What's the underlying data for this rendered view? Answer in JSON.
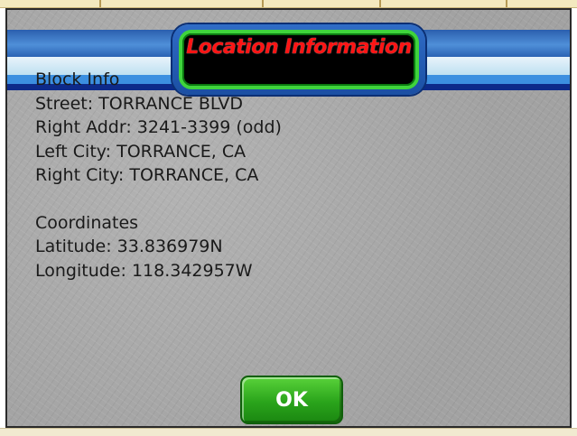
{
  "dialog": {
    "title": "Location Information",
    "block_info": {
      "heading": "Block Info",
      "street": "Street:  TORRANCE BLVD",
      "right_addr": "Right Addr:  3241-3399 (odd)",
      "left_city": "Left City:  TORRANCE, CA",
      "right_city": "Right City:  TORRANCE, CA"
    },
    "coordinates": {
      "heading": "Coordinates",
      "latitude": "Latitude:  33.836979N",
      "longitude": "Longitude:  118.342957W"
    },
    "ok_label": "OK"
  },
  "colors": {
    "title_red": "#ff1414",
    "button_green": "#2aa41b",
    "frame_green": "#3fd43c",
    "band_blue": "#2b5fae",
    "panel_gray": "#a9a9a9"
  }
}
